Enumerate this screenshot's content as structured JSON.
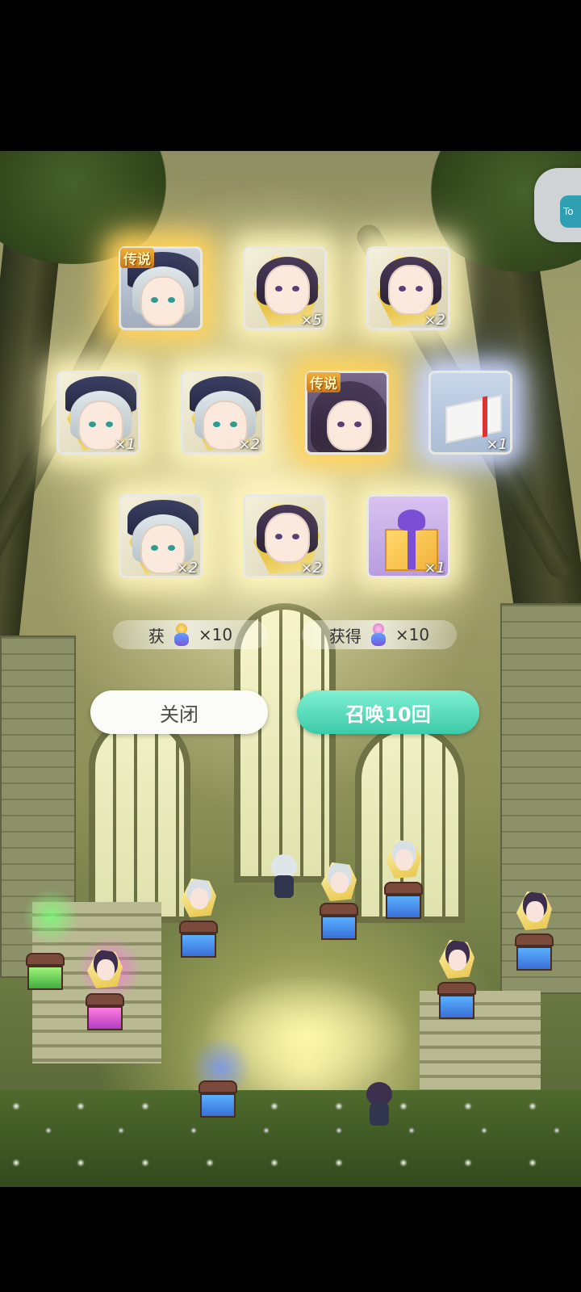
{
  "cards": [
    {
      "badge": "传说",
      "count": "",
      "kind": "portrait-light-full"
    },
    {
      "badge": "",
      "count": "×5",
      "kind": "shard-dark"
    },
    {
      "badge": "",
      "count": "×2",
      "kind": "shard-dark"
    },
    {
      "badge": "",
      "count": "×1",
      "kind": "shard-light"
    },
    {
      "badge": "",
      "count": "×2",
      "kind": "shard-light"
    },
    {
      "badge": "传说",
      "count": "",
      "kind": "portrait-dark-full"
    },
    {
      "badge": "",
      "count": "×1",
      "kind": "item-white-box"
    },
    {
      "badge": "",
      "count": "×2",
      "kind": "shard-light"
    },
    {
      "badge": "",
      "count": "×2",
      "kind": "shard-dark"
    },
    {
      "badge": "",
      "count": "×1",
      "kind": "item-gift-box"
    }
  ],
  "rewards": [
    {
      "label": "获",
      "count": "×10",
      "icon": "summon-doll-icon"
    },
    {
      "label": "获得",
      "count": "×10",
      "icon": "pink-doll-icon"
    }
  ],
  "buttons": {
    "close": "关闭",
    "summon": "召唤10回"
  },
  "side_tab": {
    "label": "To"
  },
  "colors": {
    "summon_button": "#3ccaa8",
    "legend_badge": "#f0b13a",
    "glow": "#fff6be"
  }
}
